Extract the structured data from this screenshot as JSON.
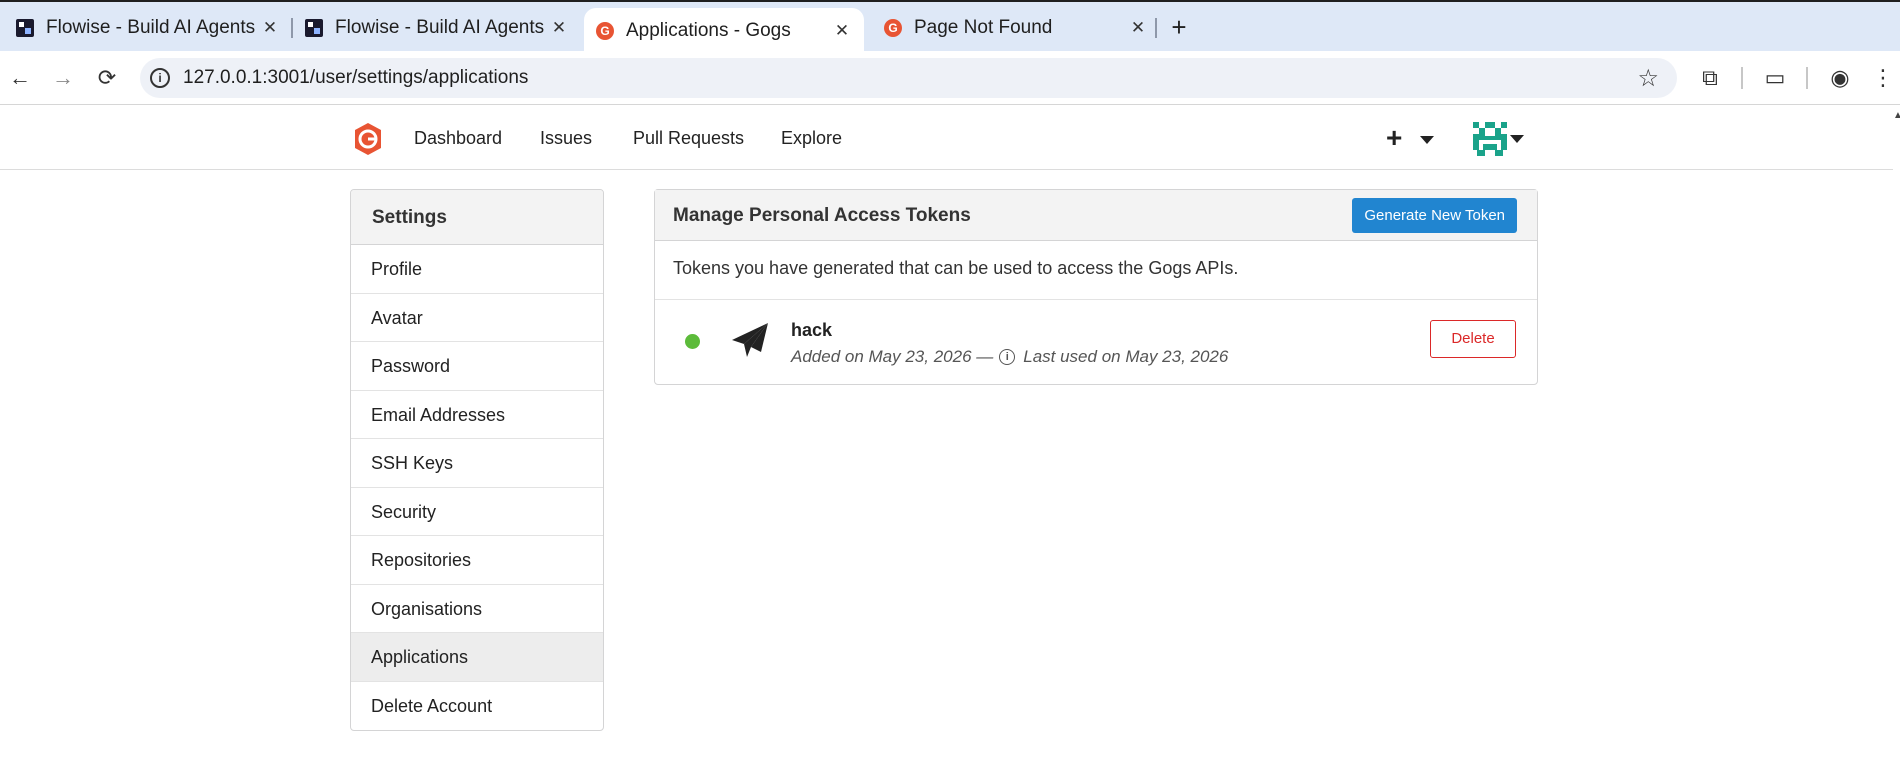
{
  "browser": {
    "tabs": [
      {
        "title": "Flowise - Build AI Agents",
        "favicon": "flowise-icon",
        "active": false
      },
      {
        "title": "Flowise - Build AI Agents",
        "favicon": "flowise-icon",
        "active": false
      },
      {
        "title": "Applications - Gogs",
        "favicon": "gogs-icon",
        "active": true
      },
      {
        "title": "Page Not Found",
        "favicon": "gogs-icon",
        "active": false
      }
    ],
    "close_glyph": "✕",
    "new_tab_glyph": "+",
    "url": "127.0.0.1:3001/user/settings/applications",
    "icons": {
      "back": "←",
      "forward": "→",
      "reload": "⟳",
      "star": "☆",
      "extensions": "⧉",
      "screen": "▭",
      "profile": "◉",
      "menu": "⋮"
    }
  },
  "header": {
    "nav": [
      "Dashboard",
      "Issues",
      "Pull Requests",
      "Explore"
    ],
    "create": "+"
  },
  "sidebar": {
    "title": "Settings",
    "items": [
      {
        "label": "Profile",
        "active": false
      },
      {
        "label": "Avatar",
        "active": false
      },
      {
        "label": "Password",
        "active": false
      },
      {
        "label": "Email Addresses",
        "active": false
      },
      {
        "label": "SSH Keys",
        "active": false
      },
      {
        "label": "Security",
        "active": false
      },
      {
        "label": "Repositories",
        "active": false
      },
      {
        "label": "Organisations",
        "active": false
      },
      {
        "label": "Applications",
        "active": true
      },
      {
        "label": "Delete Account",
        "active": false
      }
    ]
  },
  "tokens": {
    "title": "Manage Personal Access Tokens",
    "generate_label": "Generate New Token",
    "description": "Tokens you have generated that can be used to access the Gogs APIs.",
    "items": [
      {
        "name": "hack",
        "added": "Added on May 23, 2026 —",
        "last_used": "Last used on May 23, 2026",
        "status_color": "#5cbb3a",
        "delete_label": "Delete"
      }
    ]
  },
  "colors": {
    "primary": "#2185d0",
    "danger": "#db2828",
    "logo": "#e85433",
    "tabstrip": "#dee8f7"
  }
}
